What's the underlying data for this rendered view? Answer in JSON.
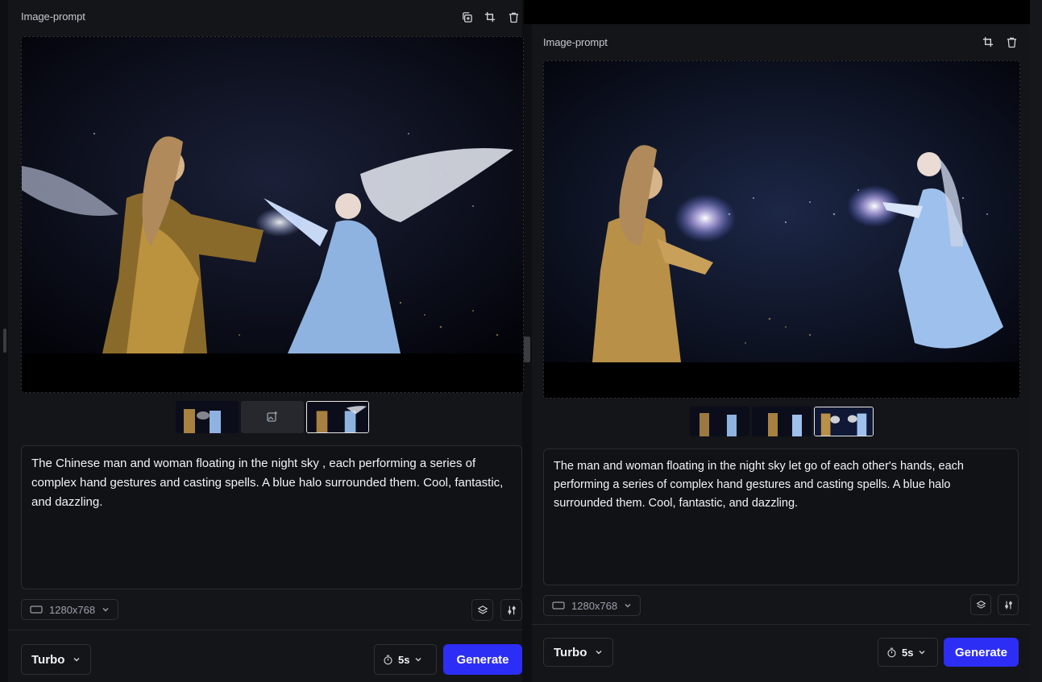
{
  "left": {
    "title": "Image-prompt",
    "prompt": "The Chinese man and woman floating in the night sky , each performing a series of complex hand gestures and casting spells. A blue halo surrounded them. Cool, fantastic, and dazzling.",
    "size": "1280x768",
    "model": "Turbo",
    "duration": "5s",
    "generate": "Generate",
    "header_icons": [
      "copy-icon",
      "crop-icon",
      "trash-icon"
    ]
  },
  "right": {
    "title": "Image-prompt",
    "prompt": "The man and woman floating in the night sky let go of each other's hands, each performing a series of complex hand gestures and casting spells. A blue halo surrounded them. Cool, fantastic, and dazzling.",
    "size": "1280x768",
    "model": "Turbo",
    "duration": "5s",
    "generate": "Generate",
    "header_icons": [
      "crop-icon",
      "trash-icon"
    ]
  },
  "colors": {
    "accent": "#2d2ef5",
    "panel_bg": "#141519"
  }
}
